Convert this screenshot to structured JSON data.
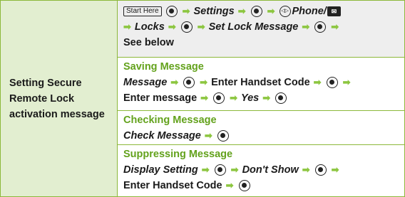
{
  "left_label": [
    "Setting Secure",
    "Remote Lock",
    "activation message"
  ],
  "path_row": {
    "start_key": "Start Here",
    "settings": "Settings",
    "phone": "Phone/",
    "mail_key_icon": "mail-key-icon",
    "locks": "Locks",
    "set_lock_message": "Set Lock Message",
    "see_below": "See below"
  },
  "saving": {
    "heading": "Saving Message",
    "message": "Message",
    "enter_handset_code": "Enter Handset Code",
    "enter_message": "Enter message",
    "yes": "Yes"
  },
  "checking": {
    "heading": "Checking Message",
    "check_message": "Check Message"
  },
  "suppressing": {
    "heading": "Suppressing Message",
    "display_setting": "Display Setting",
    "dont_show": "Don't Show",
    "enter_handset_code": "Enter Handset Code"
  },
  "icons": {
    "arrow": "➡",
    "center_key": "center-key-icon",
    "nav_key": "nav-key-icon",
    "nav_glyph": "◁▷"
  },
  "colors": {
    "border": "#8cb83a",
    "left_bg": "#e2eed0",
    "heading": "#63a21c",
    "arrow": "#8cc63f",
    "path_bg": "#eeeeee"
  }
}
